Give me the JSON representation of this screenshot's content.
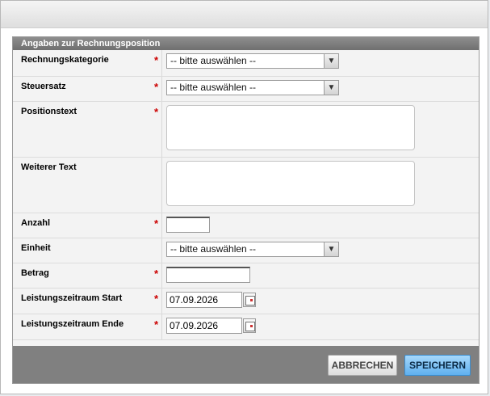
{
  "form": {
    "section_title": "Angaben zur Rechnungsposition",
    "required_mark": "*",
    "fields": {
      "rechnungskategorie": {
        "label": "Rechnungskategorie",
        "value": "-- bitte auswählen --"
      },
      "steuersatz": {
        "label": "Steuersatz",
        "value": "-- bitte auswählen --"
      },
      "positionstext": {
        "label": "Positionstext",
        "value": ""
      },
      "weiterer_text": {
        "label": "Weiterer Text",
        "value": ""
      },
      "anzahl": {
        "label": "Anzahl",
        "value": ""
      },
      "einheit": {
        "label": "Einheit",
        "value": "-- bitte auswählen --"
      },
      "betrag": {
        "label": "Betrag",
        "value": ""
      },
      "leistungszeitraum_start": {
        "label": "Leistungszeitraum Start",
        "value": "07.09.2026"
      },
      "leistungszeitraum_ende": {
        "label": "Leistungszeitraum Ende",
        "value": "07.09.2026"
      }
    }
  },
  "footer": {
    "cancel_label": "ABBRECHEN",
    "save_label": "SPEICHERN"
  },
  "icons": {
    "select_arrow": "chevron-down-icon",
    "date_picker": "calendar-icon"
  },
  "colors": {
    "required": "#cc0000",
    "section_header": "#777777",
    "footer": "#808080",
    "save_button": "#5fb0ef"
  }
}
